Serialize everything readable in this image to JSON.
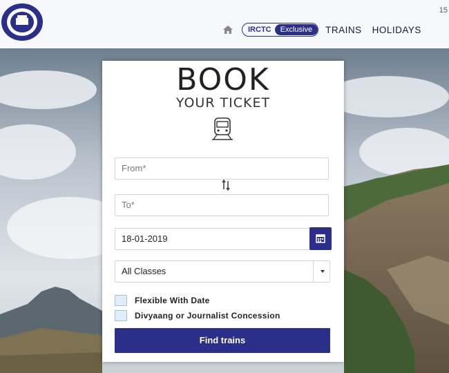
{
  "header": {
    "corner_text": "15",
    "nav": {
      "irctc_label": "IRCTC",
      "exclusive_label": "Exclusive",
      "trains_label": "TRAINS",
      "holidays_label": "HOLIDAYS"
    }
  },
  "booking": {
    "title": "BOOK",
    "subtitle": "YOUR TICKET",
    "from_placeholder": "From*",
    "to_placeholder": "To*",
    "date_value": "18-01-2019",
    "class_value": "All Classes",
    "flexible_label": "Flexible With Date",
    "concession_label": "Divyaang or Journalist Concession",
    "find_button": "Find trains"
  },
  "colors": {
    "brand": "#2b2f8a",
    "header_bg": "#f7f8fb"
  }
}
